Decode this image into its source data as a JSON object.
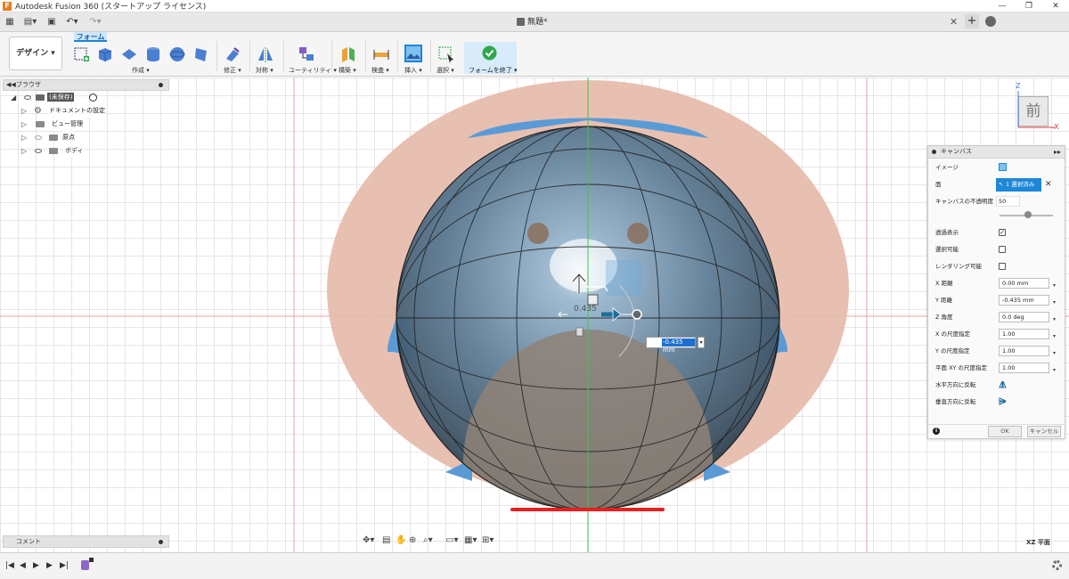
{
  "window": {
    "title": "Autodesk Fusion 360 (スタートアップ ライセンス)",
    "minimize": "—",
    "maximize": "❐",
    "close": "✕"
  },
  "appbar": {
    "grid_icon": "grid-icon",
    "file_icon": "file-icon",
    "save_icon": "save-icon",
    "undo_icon": "undo-icon",
    "redo_icon": "redo-icon",
    "doc_title": "無題*",
    "close_tab": "✕",
    "new_tab": "+"
  },
  "ribbon": {
    "workspace": "デザイン ▾",
    "active_tab": "フォーム",
    "groups": [
      {
        "label": "作成 ▾"
      },
      {
        "label": "修正 ▾"
      },
      {
        "label": "対称 ▾"
      },
      {
        "label": "ユーティリティ ▾"
      },
      {
        "label": "構築 ▾"
      },
      {
        "label": "検査 ▾"
      },
      {
        "label": "挿入 ▾"
      },
      {
        "label": "選択 ▾"
      },
      {
        "label": "フォームを終了 ▾"
      }
    ]
  },
  "browser": {
    "title": "ブラウザ",
    "root": "(未保存)",
    "items": [
      {
        "label": "ドキュメントの設定"
      },
      {
        "label": "ビュー管理"
      },
      {
        "label": "原点"
      },
      {
        "label": "ボディ"
      }
    ]
  },
  "comment": {
    "title": "コメント"
  },
  "viewcube": {
    "face": "前",
    "z_axis": "Z",
    "x_axis": "X"
  },
  "canvas_panel": {
    "title": "キャンバス",
    "image_label": "イメージ",
    "face_label": "面",
    "face_value": "1 選択済み",
    "opacity_label": "キャンバスの不透明度",
    "opacity_value": "50",
    "opacity_level": 0.5,
    "see_through_label": "透過表示",
    "see_through": true,
    "selectable_label": "選択可能",
    "selectable": false,
    "render_label": "レンダリング可能",
    "render": false,
    "x_dist_label": "X 距離",
    "x_dist": "0.00 mm",
    "y_dist_label": "Y 距離",
    "y_dist": "-0.435 mm",
    "z_angle_label": "Z 角度",
    "z_angle": "0.0 deg",
    "x_scale_label": "X の尺度指定",
    "x_scale": "1.00",
    "y_scale_label": "Y の尺度指定",
    "y_scale": "1.00",
    "xy_scale_label": "平面 XY の尺度指定",
    "xy_scale": "1.00",
    "flip_h_label": "水平方向に反転",
    "flip_v_label": "垂直方向に反転",
    "ok": "OK",
    "cancel": "キャンセル"
  },
  "manipulator": {
    "dim_value": "-0.435 mm",
    "dim_label": "0.435"
  },
  "view": {
    "plane": "XZ 平面"
  },
  "timeline": {
    "first": "⏮",
    "prev": "◀",
    "play": "▶",
    "next": "▶",
    "last": "⏭"
  },
  "colors": {
    "accent": "#1d87d8",
    "canvas_image": "#e8b8a8",
    "body_blue": "#5a9bd6",
    "red_axis": "#e62020",
    "green_axis": "#2eb82e"
  }
}
